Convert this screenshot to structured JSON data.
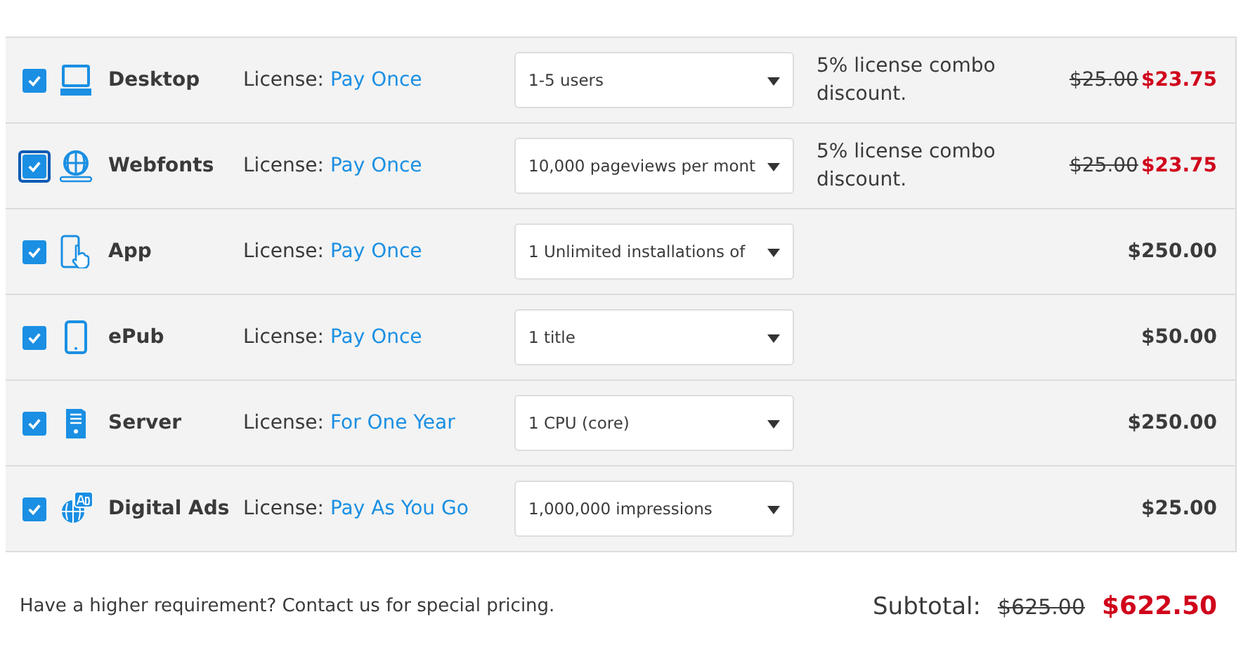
{
  "rows": [
    {
      "checked": true,
      "focused": false,
      "name": "Desktop",
      "license_label": "License:",
      "license": "Pay Once",
      "option": "1-5 users",
      "note": "5% license combo discount.",
      "original_price": "$25.00",
      "price": "$23.75"
    },
    {
      "checked": true,
      "focused": true,
      "name": "Webfonts",
      "license_label": "License:",
      "license": "Pay Once",
      "option": "10,000 pageviews per mont",
      "note": "5% license combo discount.",
      "original_price": "$25.00",
      "price": "$23.75"
    },
    {
      "checked": true,
      "focused": false,
      "name": "App",
      "license_label": "License:",
      "license": "Pay Once",
      "option": "1 Unlimited installations of",
      "price": "$250.00"
    },
    {
      "checked": true,
      "focused": false,
      "name": "ePub",
      "license_label": "License:",
      "license": "Pay Once",
      "option": "1 title",
      "price": "$50.00"
    },
    {
      "checked": true,
      "focused": false,
      "name": "Server",
      "license_label": "License:",
      "license": "For One Year",
      "option": "1 CPU (core)",
      "price": "$250.00"
    },
    {
      "checked": true,
      "focused": false,
      "name": "Digital Ads",
      "license_label": "License:",
      "license": "Pay As You Go",
      "option": "1,000,000 impressions",
      "price": "$25.00"
    }
  ],
  "footer": {
    "note": "Have a higher requirement? Contact us for special pricing.",
    "subtotal_label": "Subtotal:",
    "original_total": "$625.00",
    "total": "$622.50"
  }
}
